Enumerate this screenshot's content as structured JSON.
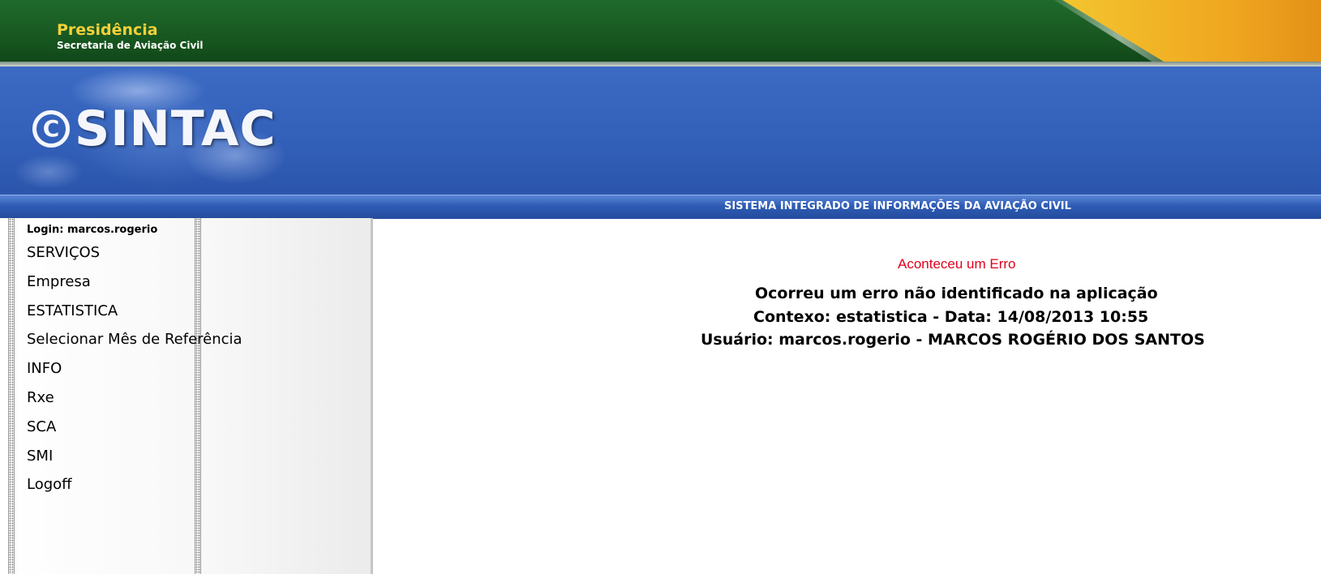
{
  "header": {
    "org_title": "Presidência",
    "org_subtitle": "Secretaria de Aviação Civil"
  },
  "banner": {
    "logo_text": "SINTAC",
    "logo_icon": "copyright-circle-icon",
    "system_name": "SISTEMA INTEGRADO DE INFORMAÇÕES DA AVIAÇÃO CIVIL"
  },
  "sidebar": {
    "login_label": "Login: marcos.rogerio",
    "items": [
      {
        "label": "SERVIÇOS"
      },
      {
        "label": "Empresa"
      },
      {
        "label": "ESTATISTICA"
      },
      {
        "label": "Selecionar Mês de Referência"
      },
      {
        "label": "INFO"
      },
      {
        "label": "Rxe"
      },
      {
        "label": "SCA"
      },
      {
        "label": "SMI"
      },
      {
        "label": "Logoff"
      }
    ]
  },
  "error": {
    "title": "Aconteceu um Erro",
    "line1": "Ocorreu um erro não identificado na aplicação",
    "line2": "Contexo: estatistica - Data: 14/08/2013 10:55",
    "line3": "Usuário: marcos.rogerio - MARCOS ROGÉRIO DOS SANTOS"
  },
  "colors": {
    "gov_green": "#1f6a2c",
    "gov_gold": "#f2d13a",
    "banner_blue": "#3c6bc4",
    "error_red": "#e0001b"
  }
}
